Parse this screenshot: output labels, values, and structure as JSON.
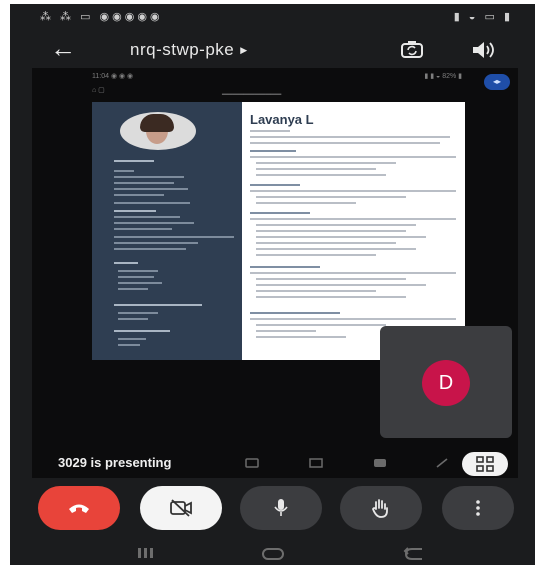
{
  "header": {
    "meeting_code": "nrq-stwp-pke"
  },
  "presentation": {
    "presenter_label": "3029 is presenting"
  },
  "participant": {
    "initial": "D",
    "avatar_color": "#c8144a"
  },
  "resume": {
    "name": "Lavanya L"
  },
  "icons": {
    "back": "arrow-left-icon",
    "switch_camera": "switch-camera-icon",
    "speaker": "speaker-icon",
    "end_call": "end-call-icon",
    "camera_off": "camera-off-icon",
    "mic": "mic-icon",
    "raise_hand": "raise-hand-icon",
    "more": "more-vertical-icon",
    "pin": "pin-icon"
  },
  "colors": {
    "end_call": "#e8443a",
    "background": "#1b1c1e",
    "control_button": "#3c3d40"
  }
}
